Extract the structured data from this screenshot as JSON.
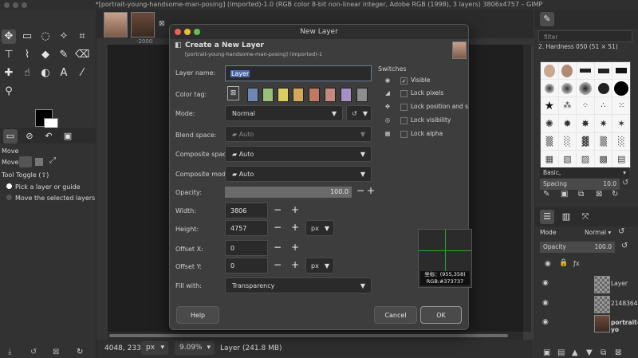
{
  "window": {
    "title": "*[portrait-young-handsome-man-posing] (imported)-1.0 (RGB color 8-bit non-linear integer, Adobe RGB (1998), 3 layers) 3806x4757 – GIMP"
  },
  "ruler": {
    "tick_2000": "-2000"
  },
  "toolbox": {
    "tools": [
      "move-icon",
      "rect-select-icon",
      "lasso-icon",
      "crop-icon",
      "transform-icon",
      "warp-icon",
      "fuzzy-select-icon",
      "bucket-fill-icon",
      "heal-icon",
      "smudge-icon",
      "text-icon",
      "color-picker-icon",
      "paintbrush-icon",
      "eraser-icon",
      "eyedropper-icon",
      "magnify-icon"
    ],
    "options_title": "Move",
    "move_label": "Move:",
    "tool_toggle": "Tool Toggle (⇧)",
    "opt1": "Pick a layer or guide",
    "opt2": "Move the selected layers"
  },
  "dialog": {
    "title": "New Layer",
    "header": "Create a New Layer",
    "subheader": "[portrait-young-handsome-man-posing] (imported)-1",
    "layer_name_label": "Layer name:",
    "layer_name_value": "Layer",
    "color_tag_label": "Color tag:",
    "color_tags": [
      "#6f86b1",
      "#9bc07a",
      "#d9cd62",
      "#d6a85a",
      "#c07a64",
      "#c38a7d",
      "#a68fc4",
      "#8e8e8e"
    ],
    "mode_label": "Mode:",
    "mode_value": "Normal",
    "blend_label": "Blend space:",
    "blend_value": "Auto",
    "composite_space_label": "Composite space:",
    "composite_space_value": "Auto",
    "composite_mode_label": "Composite mode:",
    "composite_mode_value": "Auto",
    "opacity_label": "Opacity:",
    "opacity_value": "100.0",
    "width_label": "Width:",
    "width_value": "3806",
    "height_label": "Height:",
    "height_value": "4757",
    "unit_px": "px",
    "offset_x_label": "Offset X:",
    "offset_x_value": "0",
    "offset_y_label": "Offset Y:",
    "offset_y_value": "0",
    "fill_label": "Fill with:",
    "fill_value": "Transparency",
    "switches_title": "Switches",
    "switches": [
      {
        "label": "Visible",
        "checked": true,
        "icon": "eye-icon"
      },
      {
        "label": "Lock pixels",
        "checked": false,
        "icon": "brush-lock-icon"
      },
      {
        "label": "Lock position and size",
        "checked": false,
        "icon": "move-lock-icon"
      },
      {
        "label": "Lock visibility",
        "checked": false,
        "icon": "eye-lock-icon"
      },
      {
        "label": "Lock alpha",
        "checked": false,
        "icon": "alpha-lock-icon"
      }
    ],
    "help": "Help",
    "cancel": "Cancel",
    "ok": "OK"
  },
  "preview": {
    "coord": "坐标：(955,358)",
    "rgb": "RGB:#373737"
  },
  "dock": {
    "filter_placeholder": "filter",
    "brush_name": "2. Hardness 050 (51 × 51)",
    "brush_tag": "Basic,",
    "spacing_label": "Spacing",
    "spacing_value": "10.0",
    "mode_label": "Mode",
    "mode_value": "Normal",
    "opacity_label": "Opacity",
    "opacity_value": "100.0",
    "layers": [
      {
        "name": "Layer"
      },
      {
        "name": "21483648"
      },
      {
        "name": "portrait-yo"
      }
    ]
  },
  "status": {
    "coords": "4048, 2332",
    "unit": "px",
    "zoom": "9.09%",
    "layer_info": "Layer (241.8 MB)"
  }
}
